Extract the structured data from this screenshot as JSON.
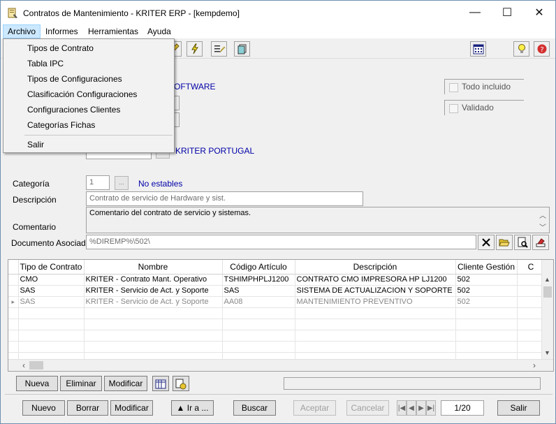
{
  "window": {
    "title": "Contratos de Mantenimiento - KRITER ERP - [kempdemo]",
    "min_glyph": "—",
    "max_glyph": "☐",
    "close_glyph": "✕"
  },
  "menubar": {
    "items": [
      {
        "label": "Archivo",
        "active": true
      },
      {
        "label": "Informes"
      },
      {
        "label": "Herramientas"
      },
      {
        "label": "Ayuda"
      }
    ]
  },
  "archivo_menu": {
    "items": [
      "Tipos de Contrato",
      "Tabla IPC",
      "Tipos de Configuraciones",
      "Clasificación Configuraciones",
      "Configuraciones Clientes",
      "Categorías Fichas"
    ],
    "exit": "Salir"
  },
  "form": {
    "partial_oftware": "OFTWARE",
    "partial_portugal": "KRITER PORTUGAL",
    "todo_incluido": "Todo incluido",
    "validado": "Validado",
    "categoria_label": "Categoría",
    "categoria_value": "1",
    "categoria_btn": "...",
    "categoria_desc": "No estables",
    "descripcion_label": "Descripción",
    "descripcion_value": "Contrato de servicio de Hardware y sist.",
    "comentario_label": "Comentario",
    "comentario_value": "Comentario del contrato de servicio y sistemas.",
    "documento_label": "Documento Asociado",
    "documento_value": "%DIREMP%\\502\\"
  },
  "grid": {
    "columns": [
      "Tipo de Contrato",
      "Nombre",
      "Código Artículo",
      "Descripción",
      "Cliente Gestión",
      "C"
    ],
    "rows": [
      {
        "indicator": "",
        "tipo": "CMO",
        "nombre": "KRITER - Contrato Mant. Operativo",
        "codigo": "TSHIMPHPLJ1200",
        "descripcion": "CONTRATO CMO IMPRESORA HP LJ1200",
        "cliente": "502"
      },
      {
        "indicator": "",
        "tipo": "SAS",
        "nombre": "KRITER - Servicio de Act. y Soporte",
        "codigo": "SAS",
        "descripcion": "SISTEMA DE ACTUALIZACION Y SOPORTE",
        "cliente": "502"
      },
      {
        "indicator": "▸",
        "tipo": "SAS",
        "nombre": "KRITER - Servicio de Act. y Soporte",
        "codigo": "AA08",
        "descripcion": "MANTENIMIENTO PREVENTIVO",
        "cliente": "502"
      }
    ]
  },
  "grid_buttons": {
    "nueva": "Nueva",
    "eliminar": "Eliminar",
    "modificar": "Modificar"
  },
  "bottom_buttons": {
    "nuevo": "Nuevo",
    "borrar": "Borrar",
    "modificar": "Modificar",
    "ir_a": "▲ Ir a ...",
    "buscar": "Buscar",
    "aceptar": "Aceptar",
    "cancelar": "Cancelar",
    "salir": "Salir"
  },
  "navigation": {
    "first": "|◀",
    "prev": "◀",
    "next": "▶",
    "last": "▶|",
    "record": "1/20"
  },
  "icons": {
    "app": "contract-book-icon",
    "colors": {
      "accent_blue": "#0000a8",
      "menu_highlight": "#cce8ff"
    }
  }
}
